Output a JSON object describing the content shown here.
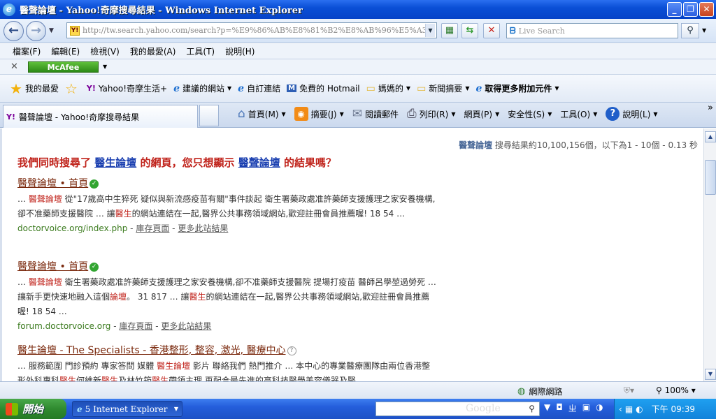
{
  "window": {
    "title": "醫聲論壇 - Yahoo!奇摩搜尋結果 - Windows Internet Explorer",
    "buttons": [
      "_",
      "❐",
      "✕"
    ]
  },
  "address_bar": {
    "url": "http://tw.search.yahoo.com/search?p=%E9%86%AB%E8%81%B2%E8%AB%96%E5%A3%87&fr=yfp&",
    "search_placeholder": "Live Search"
  },
  "menu": [
    "檔案(F)",
    "編輯(E)",
    "檢視(V)",
    "我的最愛(A)",
    "工具(T)",
    "說明(H)"
  ],
  "mcafee": {
    "label": "McAfee"
  },
  "favorites_bar": {
    "favorites_label": "我的最愛",
    "items": [
      {
        "label": "Yahoo!奇摩生活+",
        "icon": "yahoo-icon",
        "dropdown": false
      },
      {
        "label": "建議的網站",
        "icon": "ie-icon",
        "dropdown": true
      },
      {
        "label": "自訂連結",
        "icon": "ie-icon",
        "dropdown": false
      },
      {
        "label": "免費的 Hotmail",
        "icon": "msn-icon",
        "dropdown": false
      },
      {
        "label": "媽媽的",
        "icon": "folder-icon",
        "dropdown": true
      },
      {
        "label": "新聞摘要",
        "icon": "folder-icon",
        "dropdown": true
      },
      {
        "label": "取得更多附加元件",
        "icon": "ie-icon",
        "dropdown": true
      }
    ]
  },
  "tab": {
    "label": "醫聲論壇 - Yahoo!奇摩搜尋結果"
  },
  "commands": [
    {
      "label": "首頁(M)",
      "icon": "home-icon"
    },
    {
      "label": "摘要(J)",
      "icon": "rss-icon"
    },
    {
      "label": "閱讀郵件",
      "icon": "mail-icon"
    },
    {
      "label": "列印(R)",
      "icon": "print-icon"
    },
    {
      "label": "網頁(P)",
      "icon": "page-icon"
    },
    {
      "label": "安全性(S)",
      "icon": "safety-icon"
    },
    {
      "label": "工具(O)",
      "icon": "tools-icon"
    },
    {
      "label": "說明(L)",
      "icon": "help-icon"
    }
  ],
  "results_page": {
    "stats_query": "醫聲論壇",
    "stats_text": " 搜尋結果約10,100,156個，以下為1 - 10個 - 0.13 秒",
    "did_you_mean": {
      "prefix": "我們同時搜尋了",
      "term1": "醫生論壇",
      "middle": "的網頁，您只想顯示",
      "term2": "醫聲論壇",
      "suffix": "的結果嗎？"
    },
    "results": [
      {
        "title": "醫聲論壇 • 首頁",
        "snippet_parts": [
          {
            "t": "… ",
            "hl": false
          },
          {
            "t": "醫聲論壇",
            "hl": true
          },
          {
            "t": " 從\"17歲高中生猝死 疑似與新流感疫苗有關\"事件談起 衛生署藥政處准許藥師支援護理之家安養機構,卻不准藥師支援醫院 … 讓",
            "hl": false
          },
          {
            "t": "醫生",
            "hl": true
          },
          {
            "t": "的網站連結在一起,醫界公共事務領域網站,歡迎註冊會員推薦喔! 18 54 …",
            "hl": false
          }
        ],
        "url": "doctorvoice.org/index.php",
        "cache": "庫存頁面",
        "more": "更多此站結果"
      },
      {
        "title": "醫聲論壇 • 首頁",
        "snippet_parts": [
          {
            "t": "… ",
            "hl": false
          },
          {
            "t": "醫聲論壇",
            "hl": true
          },
          {
            "t": " 衛生署藥政處准許藥師支援護理之家安養機構,卻不准藥師支援醫院 提場打疫苗 醫師呂學堃過勞死 … 讓新手更快速地融入這個",
            "hl": false
          },
          {
            "t": "論壇",
            "hl": true
          },
          {
            "t": "。 31 817 … 讓",
            "hl": false
          },
          {
            "t": "醫生",
            "hl": true
          },
          {
            "t": "的網站連結在一起,醫界公共事務領域網站,歡迎註冊會員推薦喔! 18 54 …",
            "hl": false
          }
        ],
        "url": "forum.doctorvoice.org",
        "cache": "庫存頁面",
        "more": "更多此站結果"
      },
      {
        "title": "醫生論壇 - The Specialists - 香港整形, 整容, 激光, 醫療中心",
        "snippet_parts": [
          {
            "t": "… 服務範圍 門診預約 專家答問 媒體 ",
            "hl": false
          },
          {
            "t": "醫生論壇",
            "hl": true
          },
          {
            "t": " 影片 聯絡我們 熱門推介 … 本中心的專業醫療團隊由兩位香港整形外科專科",
            "hl": false
          },
          {
            "t": "醫生",
            "hl": true
          },
          {
            "t": "何維新",
            "hl": false
          },
          {
            "t": "醫生",
            "hl": true
          },
          {
            "t": "及林竹筠",
            "hl": false
          },
          {
            "t": "醫生",
            "hl": true
          },
          {
            "t": "帶領主理,再配合最先進的高科技醫學美容儀器及醫",
            "hl": false
          }
        ]
      }
    ]
  },
  "status_bar": {
    "zone": "網際網路",
    "zoom": "100%"
  },
  "taskbar": {
    "start_label": "開始",
    "task_label": "5 Internet Explorer",
    "search_watermark": "Google",
    "clock": "下午 09:39"
  }
}
